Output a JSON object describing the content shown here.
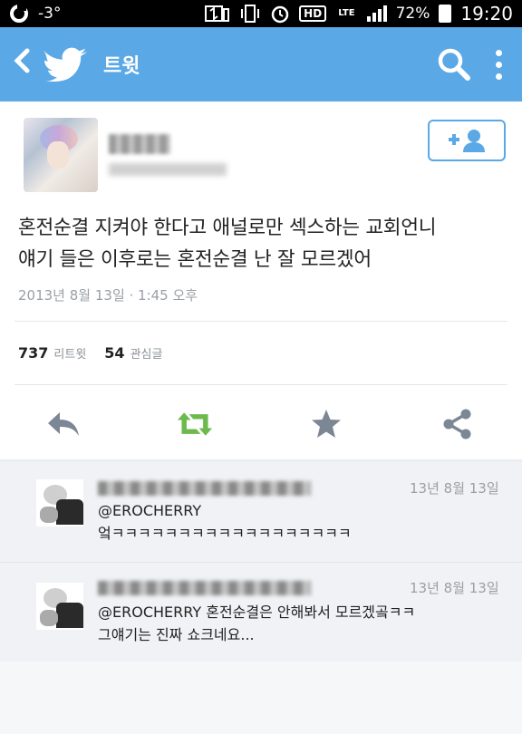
{
  "status_bar": {
    "temperature": "-3°",
    "hd_label": "HD",
    "lte_label": "LTE",
    "battery": "72%",
    "time": "19:20"
  },
  "app_bar": {
    "title": "트윗",
    "icons": [
      "back-icon",
      "twitter-bird-icon",
      "search-icon",
      "more-icon"
    ],
    "color": "#5aa8e6"
  },
  "tweet": {
    "text_line1": "혼전순결 지켜야 한다고 애널로만 섹스하는 교회언니",
    "text_line2": "얘기 들은 이후로는 혼전순결 난 잘 모르겠어",
    "timestamp": "2013년 8월 13일 · 1:45 오후",
    "retweet_count": "737",
    "retweet_label": "리트윗",
    "favorite_count": "54",
    "favorite_label": "관심글",
    "actions": [
      "reply-icon",
      "retweet-icon",
      "favorite-icon",
      "share-icon"
    ],
    "accent_green": "#6cba4e"
  },
  "replies": [
    {
      "date": "13년 8월 13일",
      "mention": "@EROCHERRY",
      "text": "엌ㅋㅋㅋㅋㅋㅋㅋㅋㅋㅋㅋㅋㅋㅋㅋㅋㅋㅋ"
    },
    {
      "date": "13년 8월 13일",
      "mention": "@EROCHERRY",
      "text_inline": "혼전순결은 안해봐서 모르겠곸ㅋㅋ",
      "text_line2": "그얘기는 진짜 쇼크네요..."
    }
  ]
}
